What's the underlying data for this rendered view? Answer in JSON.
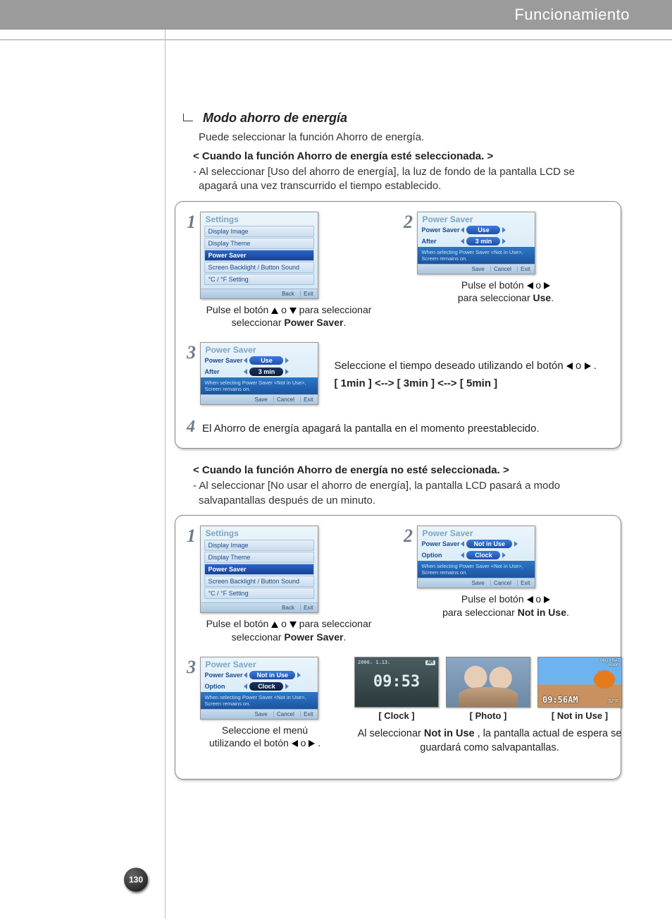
{
  "header": {
    "title": "Funcionamiento"
  },
  "page_number": "130",
  "section": {
    "title": "Modo ahorro de energía",
    "intro": "Puede seleccionar la función Ahorro de energía."
  },
  "block1": {
    "heading": "< Cuando la función Ahorro de energía esté seleccionada. >",
    "desc": "- Al seleccionar [Uso del ahorro de energía], la luz de fondo de la pantalla LCD se apagará una vez transcurrido el tiempo establecido.",
    "step1": {
      "num": "1",
      "caption_pre": "Pulse el botón ",
      "caption_mid": " o ",
      "caption_post": " para seleccionar ",
      "caption_target": "Power Saver",
      "caption_end": "."
    },
    "step2": {
      "num": "2",
      "caption_pre": "Pulse el botón ",
      "caption_mid": " o ",
      "caption_br": "para seleccionar ",
      "caption_target": "Use",
      "caption_end": "."
    },
    "step3": {
      "num": "3",
      "text_pre": "Seleccione el tiempo deseado utilizando el botón ",
      "text_mid": " o ",
      "text_end": " .",
      "options": "[ 1min ] <--> [ 3min ] <--> [ 5min ]"
    },
    "step4": {
      "num": "4",
      "text": "El Ahorro de energía apagará la pantalla en el momento preestablecido."
    },
    "panel_settings": {
      "title": "Settings",
      "items": [
        "Display Image",
        "Display Theme",
        "Power Saver",
        "Screen Backlight / Button Sound",
        "°C / °F Setting"
      ],
      "selected_index": 2,
      "footer": [
        "Back",
        "Exit"
      ]
    },
    "panel_ps_use": {
      "title": "Power Saver",
      "row1_label": "Power Saver",
      "row1_value": "Use",
      "row2_label": "After",
      "row2_value": "3 min",
      "hint": "When selecting Power Saver <Not in Use>, Screen remains on.",
      "footer": [
        "Save",
        "Cancel",
        "Exit"
      ]
    }
  },
  "block2": {
    "heading": "< Cuando la función Ahorro de energía no esté seleccionada. >",
    "desc": "- Al seleccionar [No usar el ahorro de energía], la pantalla LCD pasará a modo salvapantallas después de un minuto.",
    "step1": {
      "num": "1",
      "caption_pre": "Pulse el botón ",
      "caption_mid": " o ",
      "caption_post": " para seleccionar ",
      "caption_target": "Power Saver",
      "caption_end": "."
    },
    "step2": {
      "num": "2",
      "caption_pre": "Pulse el botón ",
      "caption_mid": " o ",
      "caption_br": "para seleccionar ",
      "caption_target": "Not in Use",
      "caption_end": "."
    },
    "step3": {
      "num": "3",
      "caption_line1": "Seleccione el menú",
      "caption_line2_pre": "utilizando el botón ",
      "caption_line2_mid": " o ",
      "caption_line2_end": " ."
    },
    "panel_ps_notuse": {
      "title": "Power Saver",
      "row1_label": "Power Saver",
      "row1_value": "Not in Use",
      "row2_label": "Option",
      "row2_value": "Clock",
      "hint": "When selecting Power Saver <Not in Use>, Screen remains on.",
      "footer": [
        "Save",
        "Cancel",
        "Exit"
      ]
    },
    "previews": {
      "clock": {
        "label": "[ Clock ]",
        "time": "09:53",
        "ampm": "AM",
        "date": "2006. 1.13."
      },
      "photo": {
        "label": "[ Photo ]"
      },
      "notinuse": {
        "label": "[ Not in Use ]",
        "time": "09:56AM",
        "room": "32°F",
        "strip_line1": "08/13 SAT",
        "strip_line2": "Room"
      }
    },
    "preview_caption_pre": "Al seleccionar ",
    "preview_caption_bold": "Not in Use",
    "preview_caption_post": ", la pantalla actual de espera se guardará como salvapantallas."
  }
}
